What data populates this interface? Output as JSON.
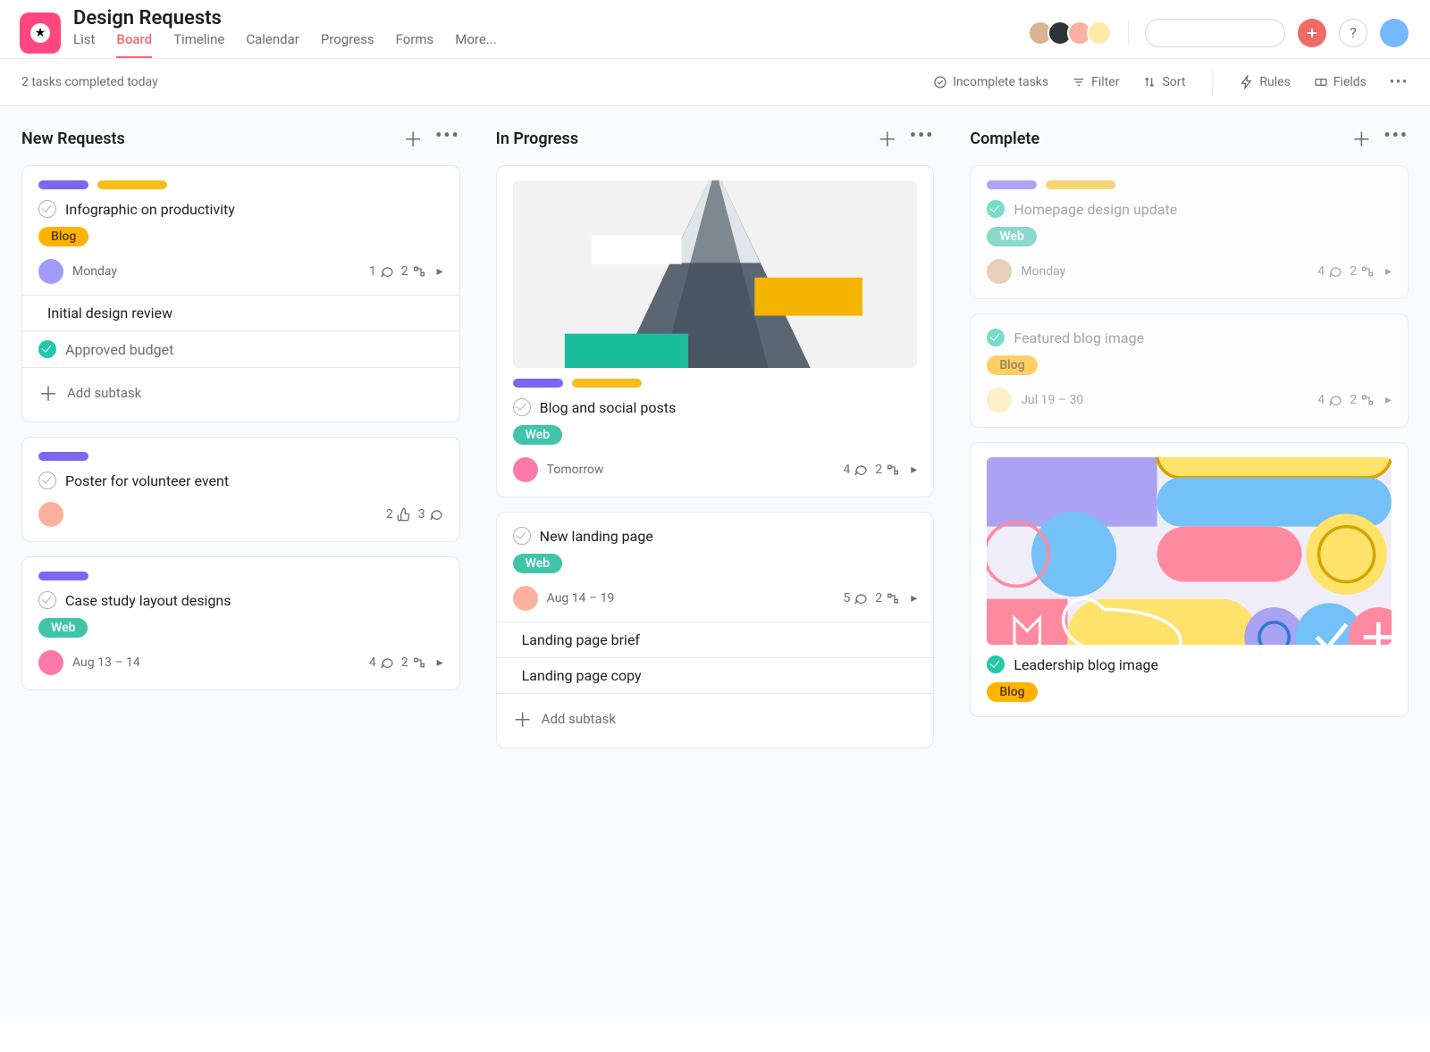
{
  "project": {
    "title": "Design Requests"
  },
  "nav_tabs": [
    "List",
    "Board",
    "Timeline",
    "Calendar",
    "Progress",
    "Forms",
    "More..."
  ],
  "nav_active": "Board",
  "search": {
    "placeholder": ""
  },
  "subheader": {
    "left": "2 tasks completed today"
  },
  "toolbar": {
    "incomplete": "Incomplete tasks",
    "filter": "Filter",
    "sort": "Sort",
    "rules": "Rules",
    "fields": "Fields"
  },
  "strings": {
    "add_subtask": "Add subtask"
  },
  "columns": [
    {
      "title": "New Requests"
    },
    {
      "title": "In Progress"
    },
    {
      "title": "Complete"
    }
  ],
  "cards": {
    "c1": {
      "title": "Infographic on productivity",
      "tag": "Blog",
      "due": "Monday",
      "comments": 1,
      "subtasks": 2,
      "subs": [
        "Initial design review",
        "Approved budget"
      ]
    },
    "c2": {
      "title": "Poster for volunteer event",
      "likes": 2,
      "comments": 3
    },
    "c3": {
      "title": "Case study layout designs",
      "tag": "Web",
      "due": "Aug 13 – 14",
      "comments": 4,
      "subtasks": 2
    },
    "c4": {
      "title": "Blog and social posts",
      "tag": "Web",
      "due": "Tomorrow",
      "comments": 4,
      "subtasks": 2
    },
    "c5": {
      "title": "New landing page",
      "tag": "Web",
      "due": "Aug 14 – 19",
      "comments": 5,
      "subtasks": 2,
      "subs": [
        "Landing page brief",
        "Landing page copy"
      ]
    },
    "c6": {
      "title": "Homepage design update",
      "tag": "Web",
      "due": "Monday",
      "comments": 4,
      "subtasks": 2
    },
    "c7": {
      "title": "Featured blog image",
      "tag": "Blog",
      "due": "Jul 19 – 30",
      "comments": 4,
      "subtasks": 2
    },
    "c8": {
      "title": "Leadership blog image",
      "tag": "Blog"
    }
  }
}
